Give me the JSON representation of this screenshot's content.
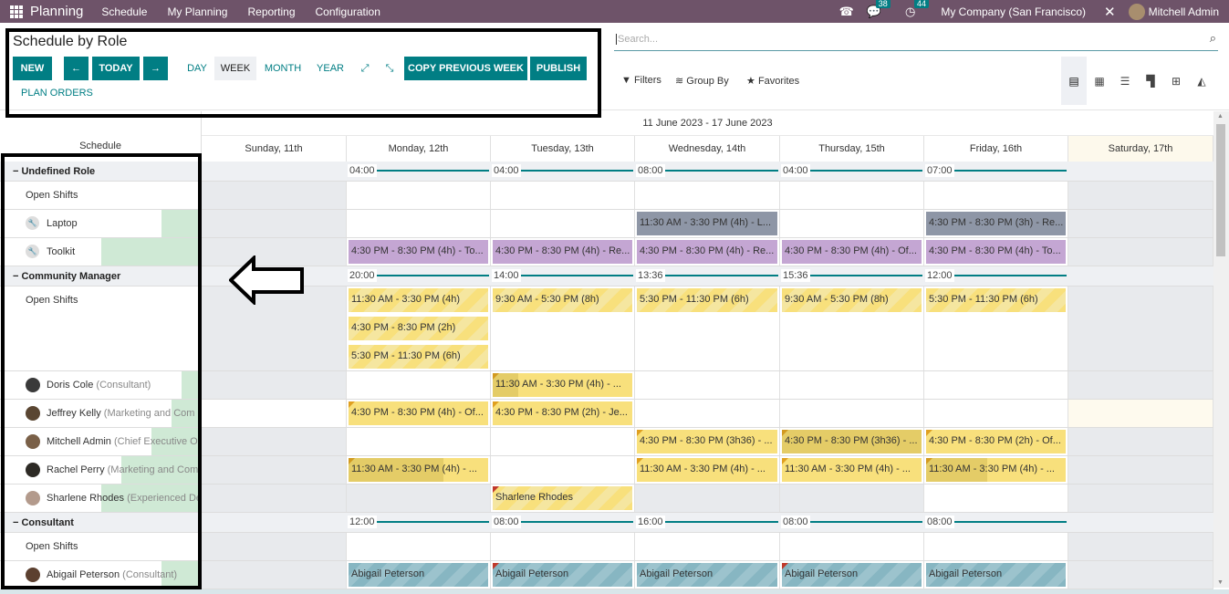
{
  "topbar": {
    "app_name": "Planning",
    "menus": [
      "Schedule",
      "My Planning",
      "Reporting",
      "Configuration"
    ],
    "phone_icon": "phone-icon",
    "messages_count": "38",
    "activities_count": "44",
    "company": "My Company (San Francisco)",
    "user": "Mitchell Admin"
  },
  "control_panel": {
    "title": "Schedule by Role",
    "buttons": {
      "new": "NEW",
      "prev": "←",
      "today": "TODAY",
      "next": "→",
      "copy_previous_week": "COPY PREVIOUS WEEK",
      "publish": "PUBLISH",
      "plan_orders": "PLAN ORDERS"
    },
    "scales": [
      "DAY",
      "WEEK",
      "MONTH",
      "YEAR"
    ],
    "active_scale": "WEEK",
    "expand_icon": "⤢",
    "collapse_icon": "⤡",
    "search_placeholder": "Search...",
    "filters": "Filters",
    "group_by": "Group By",
    "favorites": "Favorites",
    "views": [
      "gantt",
      "calendar",
      "list",
      "kanban",
      "pivot",
      "graph"
    ],
    "active_view": "gantt"
  },
  "gantt": {
    "left_header": "Schedule",
    "range": "11 June 2023 - 17 June 2023",
    "days": [
      "Sunday, 11th",
      "Monday, 12th",
      "Tuesday, 13th",
      "Wednesday, 14th",
      "Thursday, 15th",
      "Friday, 16th",
      "Saturday, 17th"
    ],
    "groups": [
      {
        "name": "Undefined Role",
        "totals": [
          "",
          "04:00",
          "04:00",
          "08:00",
          "04:00",
          "07:00",
          ""
        ],
        "rows": [
          {
            "label": "Open Shifts",
            "sub": "",
            "icon": "",
            "progress": 0,
            "shifts": [
              [],
              [],
              [],
              [],
              [],
              [],
              []
            ]
          },
          {
            "label": "Laptop",
            "sub": "",
            "icon": "wrench",
            "progress": 0.2,
            "shifts": [
              [],
              [],
              [],
              [
                {
                  "text": "11:30 AM - 3:30 PM (4h) - L...",
                  "style": "grey"
                }
              ],
              [],
              [
                {
                  "text": "4:30 PM - 8:30 PM (3h) - Re...",
                  "style": "grey"
                }
              ],
              []
            ]
          },
          {
            "label": "Toolkit",
            "sub": "",
            "icon": "wrench",
            "progress": 0.5,
            "shifts": [
              [],
              [
                {
                  "text": "4:30 PM - 8:30 PM (4h) - To...",
                  "style": "purple"
                }
              ],
              [
                {
                  "text": "4:30 PM - 8:30 PM (4h) - Re...",
                  "style": "purple"
                }
              ],
              [
                {
                  "text": "4:30 PM - 8:30 PM (4h) - Re...",
                  "style": "purple"
                }
              ],
              [
                {
                  "text": "4:30 PM - 8:30 PM (4h) - Of...",
                  "style": "purple"
                }
              ],
              [
                {
                  "text": "4:30 PM - 8:30 PM (4h) - To...",
                  "style": "purple"
                }
              ],
              []
            ]
          }
        ]
      },
      {
        "name": "Community Manager",
        "totals": [
          "",
          "20:00",
          "14:00",
          "13:36",
          "15:36",
          "12:00",
          ""
        ],
        "rows": [
          {
            "label": "Open Shifts",
            "sub": "",
            "icon": "",
            "progress": 0,
            "shifts": [
              [],
              [
                {
                  "text": "11:30 AM - 3:30 PM (4h)",
                  "style": "ystripe"
                },
                {
                  "text": "4:30 PM - 8:30 PM (2h)",
                  "style": "ystripe"
                },
                {
                  "text": "5:30 PM - 11:30 PM (6h)",
                  "style": "ystripe"
                }
              ],
              [
                {
                  "text": "9:30 AM - 5:30 PM (8h)",
                  "style": "ystripe"
                }
              ],
              [
                {
                  "text": "5:30 PM - 11:30 PM (6h)",
                  "style": "ystripe"
                }
              ],
              [
                {
                  "text": "9:30 AM - 5:30 PM (8h)",
                  "style": "ystripe"
                }
              ],
              [
                {
                  "text": "5:30 PM - 11:30 PM (6h)",
                  "style": "ystripe"
                }
              ],
              []
            ]
          },
          {
            "label": "Doris Cole",
            "sub": "(Consultant)",
            "icon": "avatar",
            "progress": 0.1,
            "shifts": [
              [],
              [],
              [
                {
                  "text": "11:30 AM - 3:30 PM (4h) - ...",
                  "style": "yellow",
                  "corner": "orange",
                  "done": 0.18
                }
              ],
              [],
              [],
              [],
              []
            ]
          },
          {
            "label": "Jeffrey Kelly",
            "sub": "(Marketing and Com",
            "icon": "avatar",
            "progress": 0.15,
            "shifts": [
              [],
              [
                {
                  "text": "4:30 PM - 8:30 PM (4h) - Of...",
                  "style": "yellow",
                  "corner": "orange"
                }
              ],
              [
                {
                  "text": "4:30 PM - 8:30 PM (2h) - Je...",
                  "style": "yellow",
                  "corner": "orange"
                }
              ],
              [],
              [],
              [],
              []
            ]
          },
          {
            "label": "Mitchell Admin",
            "sub": "(Chief Executive O",
            "icon": "avatar",
            "progress": 0.25,
            "shifts": [
              [],
              [],
              [],
              [
                {
                  "text": "4:30 PM - 8:30 PM (3h36) - ...",
                  "style": "yellow",
                  "corner": "orange"
                }
              ],
              [
                {
                  "text": "4:30 PM - 8:30 PM (3h36) - ...",
                  "style": "yellow",
                  "corner": "orange",
                  "done": 1
                }
              ],
              [
                {
                  "text": "4:30 PM - 8:30 PM (2h) - Of...",
                  "style": "yellow",
                  "corner": "orange"
                }
              ],
              []
            ]
          },
          {
            "label": "Rachel Perry",
            "sub": "(Marketing and Com",
            "icon": "avatar",
            "progress": 0.4,
            "shifts": [
              [],
              [
                {
                  "text": "11:30 AM - 3:30 PM (4h) - ...",
                  "style": "yellow",
                  "corner": "orange",
                  "done": 0.68
                }
              ],
              [],
              [
                {
                  "text": "11:30 AM - 3:30 PM (4h) - ...",
                  "style": "yellow",
                  "corner": "orange"
                }
              ],
              [
                {
                  "text": "11:30 AM - 3:30 PM (4h) - ...",
                  "style": "yellow",
                  "corner": "orange"
                }
              ],
              [
                {
                  "text": "11:30 AM - 3:30 PM (4h) - ...",
                  "style": "yellow",
                  "corner": "orange",
                  "done": 0.44
                }
              ],
              []
            ]
          },
          {
            "label": "Sharlene Rhodes",
            "sub": "(Experienced De",
            "icon": "avatar",
            "progress": 0.5,
            "shifts": [
              [],
              [],
              [
                {
                  "text": "Sharlene Rhodes",
                  "style": "ystripe",
                  "corner": "red"
                }
              ],
              [],
              [],
              [],
              []
            ]
          }
        ]
      },
      {
        "name": "Consultant",
        "totals": [
          "",
          "12:00",
          "08:00",
          "16:00",
          "08:00",
          "08:00",
          ""
        ],
        "rows": [
          {
            "label": "Open Shifts",
            "sub": "",
            "icon": "",
            "progress": 0,
            "shifts": [
              [],
              [],
              [],
              [],
              [],
              [],
              []
            ]
          },
          {
            "label": "Abigail Peterson",
            "sub": "(Consultant)",
            "icon": "avatar",
            "progress": 0.2,
            "shifts": [
              [],
              [
                {
                  "text": "Abigail Peterson",
                  "style": "blue"
                }
              ],
              [
                {
                  "text": "Abigail Peterson",
                  "style": "blue",
                  "corner": "red"
                }
              ],
              [
                {
                  "text": "Abigail Peterson",
                  "style": "blue"
                }
              ],
              [
                {
                  "text": "Abigail Peterson",
                  "style": "blue",
                  "corner": "red"
                }
              ],
              [
                {
                  "text": "Abigail Peterson",
                  "style": "blue"
                }
              ],
              []
            ]
          }
        ]
      }
    ]
  }
}
